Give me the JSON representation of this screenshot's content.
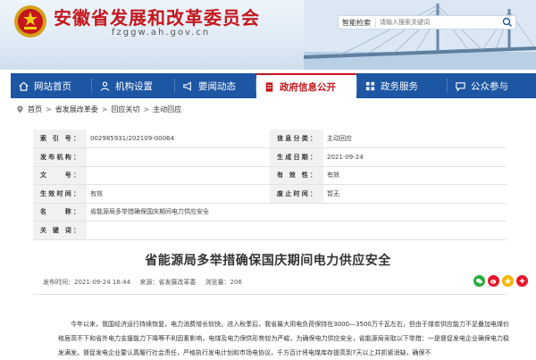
{
  "header": {
    "site_title": "安徽省发展和改革委员会",
    "domain": "fzggw.ah.gov.cn",
    "search_label": "智能检索",
    "search_placeholder": "请输入搜索关键词"
  },
  "nav": {
    "items": [
      {
        "label": "网站首页",
        "icon": "home-icon"
      },
      {
        "label": "机构设置",
        "icon": "org-icon"
      },
      {
        "label": "要闻动态",
        "icon": "megaphone-icon"
      },
      {
        "label": "政府信息公开",
        "icon": "document-icon",
        "active": true
      },
      {
        "label": "政务服务",
        "icon": "service-icon"
      },
      {
        "label": "公众参与",
        "icon": "chat-icon"
      }
    ]
  },
  "breadcrumb": [
    "首页",
    "省发展改革委",
    "回应关切",
    "主动回应"
  ],
  "meta": {
    "index_no_key": "索 引 号：",
    "index_no": "002985931/202109-00064",
    "info_class_key": "信息分类：",
    "info_class": "主动回应",
    "issuer_key": "发布机构：",
    "issuer": "",
    "pub_date_key": "生成日期：",
    "pub_date": "2021-09-24",
    "doc_no_key": "文　　号：",
    "doc_no": "",
    "validity_key": "有 效 性：",
    "validity": "有效",
    "effective_key": "生效时间：",
    "effective": "有效",
    "abolish_key": "废止时间：",
    "abolish": "暂无",
    "name_key": "名　　称：",
    "name": "省能源局多举措确保国庆期间电力供应安全",
    "keywords_key": "关 键 词：",
    "keywords": ""
  },
  "article": {
    "title": "省能源局多举措确保国庆期间电力供应安全",
    "publish_time": "发布时间：2021-09-24 16:44",
    "source": "来源：省发展改革委",
    "views": "浏览量：206",
    "body": "今年以来，我国经济运行持续恢复，电力消费增长较快。进入秋季后，我省最大用电负荷保持在3000—3500万千瓦左右，但由于煤炭供应能力不足叠加电煤价格居高不下和省外电力支援能力下降等不利因素影响，电煤及电力保供形势较为严峻，为确保电力供应安全，省能源局采取以下举措：一是督促发电企业确保电力稳发满发。督促发电企业要认真履行社会责任，严格执行发电计划和市场电协议，千方百计将电煤库存提高到7天以上并抓紧消缺，确保不"
  },
  "share": [
    {
      "icon": "wechat-icon",
      "color": "#2aae38"
    },
    {
      "icon": "weibo-icon",
      "color": "#e6162d"
    },
    {
      "icon": "qzone-icon",
      "color": "#f5b700"
    },
    {
      "icon": "more-icon",
      "color": "#e6162d"
    }
  ],
  "colors": {
    "brand_red": "#c4161c",
    "nav_blue": "#1d56a3"
  }
}
